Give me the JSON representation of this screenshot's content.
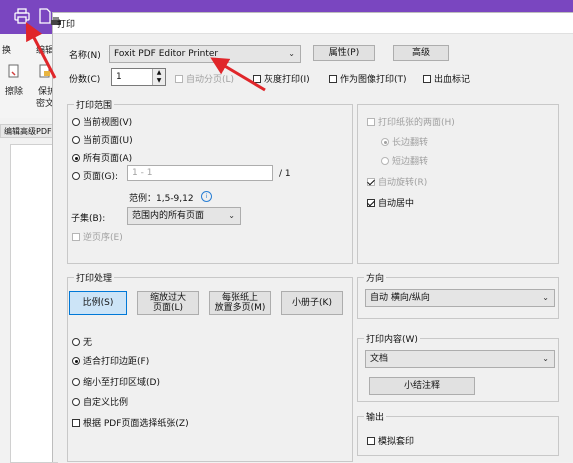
{
  "app": {
    "toolbar_tab_left": "换",
    "toolbar_tab_edit": "编辑",
    "erase_label": "擦除",
    "protect_label": "保护",
    "encrypt_label": "密文",
    "panel_tab": "编辑高级PDF"
  },
  "dialog": {
    "title": "打印",
    "printer_name_label": "名称(N)",
    "printer_name_value": "Foxit PDF Editor Printer",
    "properties_button": "属性(P)",
    "advanced_button": "高级",
    "copies_label": "份数(C)",
    "copies_value": "1",
    "collate_label": "自动分页(L)",
    "grayscale_label": "灰度打印(I)",
    "print_as_image_label": "作为图像打印(T)",
    "bleed_marks_label": "出血标记",
    "print_range": {
      "legend": "打印范围",
      "current_view": "当前视图(V)",
      "current_page": "当前页面(U)",
      "all_pages": "所有页面(A)",
      "pages": "页面(G):",
      "pages_placeholder": "1 - 1",
      "pages_total": "/ 1",
      "example": "范例：1,5-9,12",
      "subset_label": "子集(B):",
      "subset_value": "范围内的所有页面",
      "reverse_label": "逆页序(E)"
    },
    "duplex": {
      "both_sides": "打印纸张的两面(H)",
      "long_edge": "长边翻转",
      "short_edge": "短边翻转",
      "auto_rotate": "自动旋转(R)",
      "auto_center": "自动居中"
    },
    "handling": {
      "legend": "打印处理",
      "scale_button": "比例(S)",
      "fit_line1": "缩放过大",
      "fit_line2": "页面(L)",
      "multiple_line1": "每张纸上",
      "multiple_line2": "放置多页(M)",
      "booklet_button": "小册子(K)",
      "none": "无",
      "fit_margins": "适合打印边距(F)",
      "shrink": "缩小至打印区域(D)",
      "custom": "自定义比例",
      "choose_paper": "根据 PDF页面选择纸张(Z)"
    },
    "orientation": {
      "legend": "方向",
      "value": "自动 横向/纵向"
    },
    "content": {
      "legend": "打印内容(W)",
      "value": "文档",
      "summarize_button": "小结注释"
    },
    "output": {
      "legend": "输出",
      "simulate_overprint": "模拟套印"
    }
  },
  "colors": {
    "title_bar": "#7a46c0",
    "annotation_arrow": "#e0262a",
    "selected_button_border": "#0078d7"
  }
}
